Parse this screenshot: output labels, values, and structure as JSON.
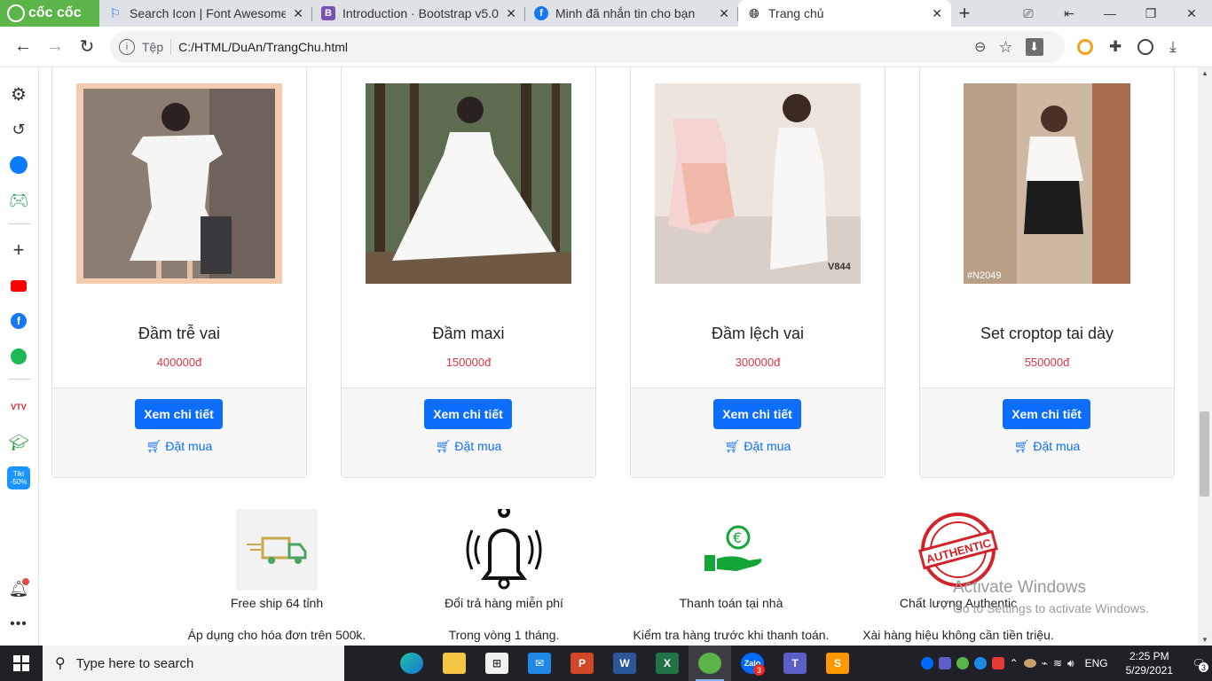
{
  "browser": {
    "brand": "cốc cốc",
    "tabs": [
      {
        "title": "Search Icon | Font Awesome",
        "icon": "flag-icon"
      },
      {
        "title": "Introduction · Bootstrap v5.0",
        "icon": "bootstrap-icon"
      },
      {
        "title": "Minh đã nhắn tin cho bạn",
        "icon": "facebook-icon"
      },
      {
        "title": "Trang chủ",
        "icon": "globe-icon",
        "active": true
      }
    ],
    "address": {
      "scheme_label": "Tệp",
      "url": "C:/HTML/DuAn/TrangChu.html"
    }
  },
  "products": [
    {
      "name": "Đầm trễ vai",
      "price": "400000đ",
      "detail_label": "Xem chi tiết",
      "buy_label": "Đặt mua"
    },
    {
      "name": "Đầm maxi",
      "price": "150000đ",
      "detail_label": "Xem chi tiết",
      "buy_label": "Đặt mua"
    },
    {
      "name": "Đầm lệch vai",
      "price": "300000đ",
      "detail_label": "Xem chi tiết",
      "buy_label": "Đặt mua",
      "image_text": "V844"
    },
    {
      "name": "Set croptop tai dày",
      "price": "550000đ",
      "detail_label": "Xem chi tiết",
      "buy_label": "Đặt mua",
      "image_text": "#N2049"
    }
  ],
  "features": [
    {
      "title": "Free ship 64 tỉnh",
      "desc": "Áp dụng cho hóa đơn trên 500k."
    },
    {
      "title": "Đổi trả hàng miễn phí",
      "desc": "Trong vòng 1 tháng."
    },
    {
      "title": "Thanh toán tại nhà",
      "desc": "Kiểm tra hàng trước khi thanh toán."
    },
    {
      "title": "Chất lượng Authentic",
      "desc": "Xài hàng hiệu không cần tiền triệu.",
      "stamp_text": "AUTHENTIC"
    }
  ],
  "watermark": {
    "title": "Activate Windows",
    "subtitle": "Go to Settings to activate Windows."
  },
  "taskbar": {
    "search_placeholder": "Type here to search",
    "lang": "ENG",
    "time": "2:25 PM",
    "date": "5/29/2021",
    "notification_count": "3",
    "zalo_badge": "3"
  },
  "sidebar": {
    "tiki_label": "Tiki",
    "tiki_badge": "-50%",
    "vtv_label": "VTV"
  },
  "colors": {
    "primary": "#0d6efd",
    "price": "#dc3545",
    "coccoc_green": "#5bb548"
  }
}
